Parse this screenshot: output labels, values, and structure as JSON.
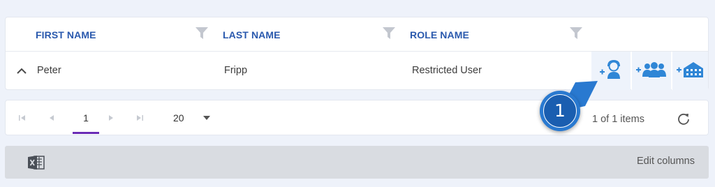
{
  "grid": {
    "columns": [
      {
        "title": "FIRST NAME"
      },
      {
        "title": "LAST NAME"
      },
      {
        "title": "ROLE NAME"
      }
    ],
    "rows": [
      {
        "first_name": "Peter",
        "last_name": "Fripp",
        "role_name": "Restricted User"
      }
    ],
    "row_actions": [
      {
        "icon": "add-user-icon"
      },
      {
        "icon": "add-group-icon"
      },
      {
        "icon": "add-organization-icon"
      }
    ]
  },
  "pager": {
    "current_page": "1",
    "page_size": "20",
    "items_info": "1 of 1 items"
  },
  "callout": {
    "number": "1"
  },
  "footer": {
    "edit_columns_label": "Edit columns"
  },
  "colors": {
    "header_text": "#2a59ad",
    "accent_purple": "#6a2bb5",
    "callout_blue": "#1a5eb0",
    "action_icon_blue": "#2f86d6"
  }
}
